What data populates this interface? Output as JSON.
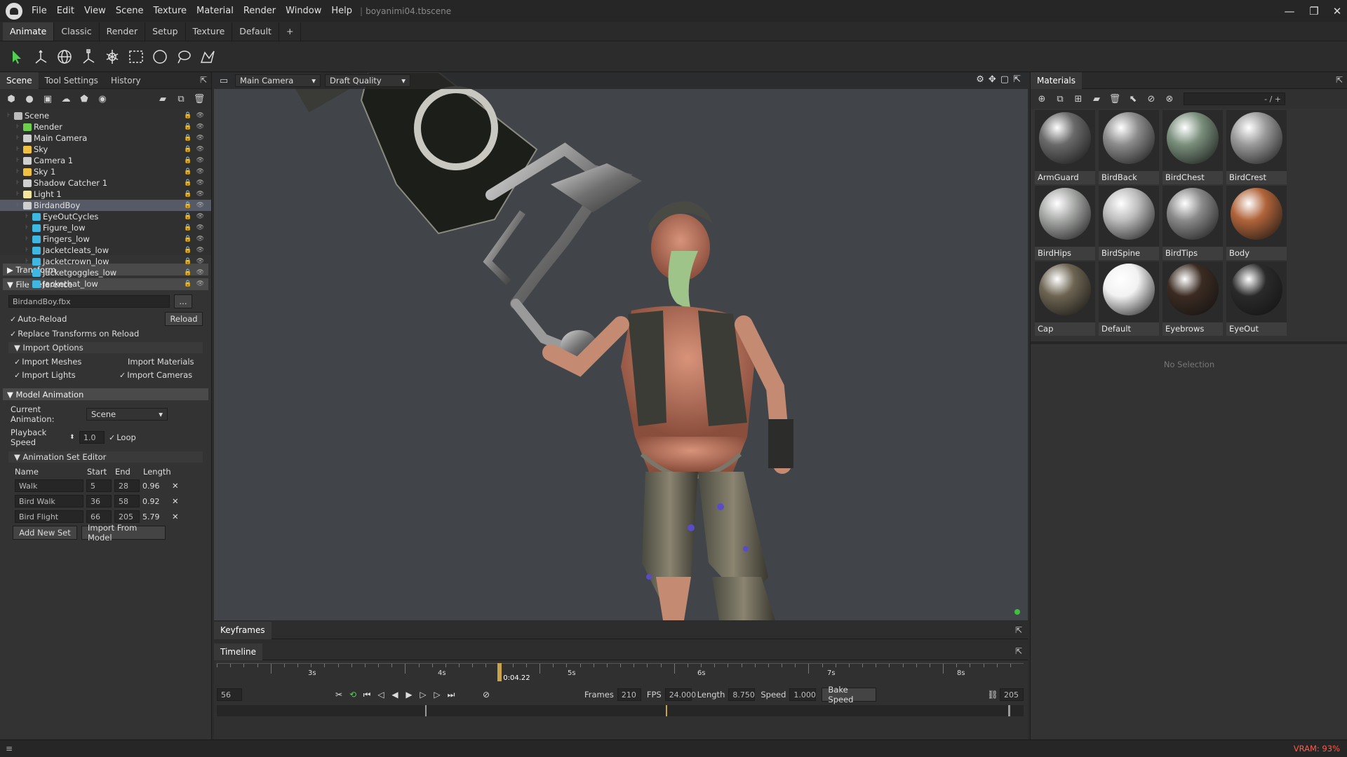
{
  "app": {
    "menu": [
      "File",
      "Edit",
      "View",
      "Scene",
      "Texture",
      "Material",
      "Render",
      "Window",
      "Help"
    ],
    "file_name": "boyanimi04.tbscene",
    "window_controls": {
      "minimize": "—",
      "maximize": "❐",
      "close": "✕"
    }
  },
  "layout_tabs": [
    "Animate",
    "Classic",
    "Render",
    "Setup",
    "Texture",
    "Default",
    "+"
  ],
  "toolbar_icons": [
    "select-arrow-icon",
    "move-transform-icon",
    "rotate-transform-icon",
    "scale-transform-icon",
    "lights-transform-icon",
    "box-select-icon",
    "circle-select-icon",
    "lasso-select-icon",
    "paint-select-icon"
  ],
  "left_panel": {
    "tabs": [
      "Scene",
      "Tool Settings",
      "History"
    ],
    "scene_tree": [
      {
        "label": "Scene",
        "depth": 0,
        "color": "#bbbbbb"
      },
      {
        "label": "Render",
        "depth": 1,
        "color": "#6ccf4d"
      },
      {
        "label": "Main Camera",
        "depth": 1,
        "color": "#cfcfcf"
      },
      {
        "label": "Sky",
        "depth": 1,
        "color": "#f0c040"
      },
      {
        "label": "Camera 1",
        "depth": 1,
        "color": "#cfcfcf"
      },
      {
        "label": "Sky 1",
        "depth": 1,
        "color": "#f0c040"
      },
      {
        "label": "Shadow Catcher 1",
        "depth": 1,
        "color": "#cfcfcf"
      },
      {
        "label": "Light 1",
        "depth": 1,
        "color": "#f5e3a0"
      },
      {
        "label": "BirdandBoy",
        "depth": 1,
        "color": "#cfcfcf",
        "selected": true
      },
      {
        "label": "EyeOutCycles",
        "depth": 2,
        "color": "#3fb7e0"
      },
      {
        "label": "Figure_low",
        "depth": 2,
        "color": "#3fb7e0"
      },
      {
        "label": "Fingers_low",
        "depth": 2,
        "color": "#3fb7e0"
      },
      {
        "label": "Jacketcleats_low",
        "depth": 2,
        "color": "#3fb7e0"
      },
      {
        "label": "Jacketcrown_low",
        "depth": 2,
        "color": "#3fb7e0"
      },
      {
        "label": "Jacketgoggles_low",
        "depth": 2,
        "color": "#3fb7e0"
      },
      {
        "label": "Jackethat_low",
        "depth": 2,
        "color": "#3fb7e0"
      }
    ],
    "transform_label": "Transform",
    "file_reference_label": "File Reference",
    "file_name": "BirdandBoy.fbx",
    "browse_label": "...",
    "auto_reload": "Auto-Reload",
    "reload_btn": "Reload",
    "replace_transforms": "Replace Transforms on Reload",
    "import_options": "Import Options",
    "import_meshes": "Import Meshes",
    "import_materials": "Import Materials",
    "import_lights": "Import Lights",
    "import_cameras": "Import Cameras",
    "model_animation": "Model Animation",
    "current_animation_label": "Current Animation:",
    "current_animation_value": "Scene",
    "playback_speed_label": "Playback Speed",
    "playback_speed_value": "1.0",
    "loop_label": "Loop",
    "anim_set_editor": "Animation Set Editor",
    "anim_headers": [
      "Name",
      "Start",
      "End",
      "Length"
    ],
    "anim_sets": [
      {
        "name": "Walk",
        "start": "5",
        "end": "28",
        "length": "0.96"
      },
      {
        "name": "Bird Walk",
        "start": "36",
        "end": "58",
        "length": "0.92"
      },
      {
        "name": "Bird Flight",
        "start": "66",
        "end": "205",
        "length": "5.79"
      }
    ],
    "add_new_set": "Add New Set",
    "import_from_model": "Import From Model"
  },
  "viewport": {
    "camera": "Main Camera",
    "quality": "Draft Quality"
  },
  "materials_panel": {
    "title": "Materials",
    "page_indicator": "- / +",
    "materials": [
      {
        "name": "ArmGuard",
        "color": "#6a6a6a"
      },
      {
        "name": "BirdBack",
        "color": "#8c8c8c"
      },
      {
        "name": "BirdChest",
        "color": "#7a8f7c"
      },
      {
        "name": "BirdCrest",
        "color": "#9a9a9a"
      },
      {
        "name": "BirdHips",
        "color": "#a8aaa8"
      },
      {
        "name": "BirdSpine",
        "color": "#bdbdbd"
      },
      {
        "name": "BirdTips",
        "color": "#8a8a8a"
      },
      {
        "name": "Body",
        "color": "#b0643a"
      },
      {
        "name": "Cap",
        "color": "#6d6452"
      },
      {
        "name": "Default",
        "color": "#f2f2f2"
      },
      {
        "name": "Eyebrows",
        "color": "#3b2b22"
      },
      {
        "name": "EyeOut",
        "color": "#2a2a2a"
      }
    ],
    "no_selection": "No Selection"
  },
  "keyframes_tab": "Keyframes",
  "timeline": {
    "title": "Timeline",
    "ticks": [
      "3s",
      "4s",
      "5s",
      "6s",
      "7s",
      "8s"
    ],
    "playhead_time": "0:04.22",
    "current_frame": "56",
    "frames_label": "Frames",
    "frames_value": "210",
    "fps_label": "FPS",
    "fps_value": "24.000",
    "length_label": "Length",
    "length_value": "8.750",
    "speed_label": "Speed",
    "speed_value": "1.000",
    "bake_speed": "Bake Speed",
    "end_frame": "205",
    "playhead_fraction": 0.435
  },
  "status": {
    "vram": "VRAM: 93%"
  },
  "colors": {
    "accent_select": "#555a66",
    "vram_text": "#ff5a4a",
    "playhead": "#c7a44a",
    "light_dot": "#3ec23e"
  }
}
